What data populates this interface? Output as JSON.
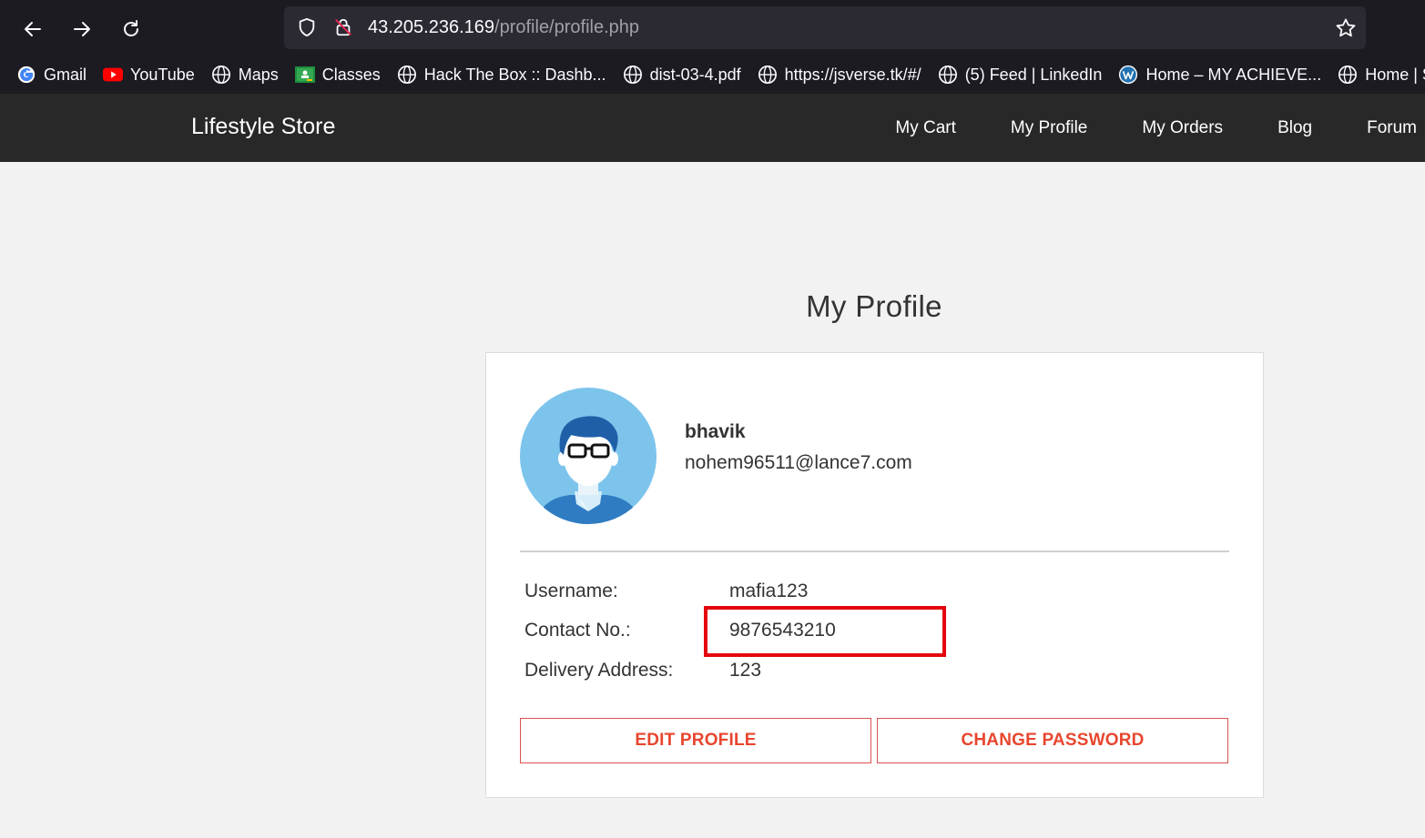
{
  "browser": {
    "url_host": "43.205.236.169",
    "url_path": "/profile/profile.php",
    "bookmarks": [
      {
        "label": "Gmail",
        "icon": "google-icon"
      },
      {
        "label": "YouTube",
        "icon": "youtube-icon"
      },
      {
        "label": "Maps",
        "icon": "globe-icon"
      },
      {
        "label": "Classes",
        "icon": "classroom-icon"
      },
      {
        "label": "Hack The Box :: Dashb...",
        "icon": "globe-icon"
      },
      {
        "label": "dist-03-4.pdf",
        "icon": "globe-icon"
      },
      {
        "label": "https://jsverse.tk/#/",
        "icon": "globe-icon"
      },
      {
        "label": "(5) Feed | LinkedIn",
        "icon": "globe-icon"
      },
      {
        "label": "Home – MY ACHIEVE...",
        "icon": "wordpress-icon"
      },
      {
        "label": "Home | Sp",
        "icon": "globe-icon"
      }
    ]
  },
  "site": {
    "brand": "Lifestyle Store",
    "menu": [
      "My Cart",
      "My Profile",
      "My Orders",
      "Blog",
      "Forum"
    ]
  },
  "profile": {
    "title": "My Profile",
    "name": "bhavik",
    "email": "nohem96511@lance7.com",
    "fields": [
      {
        "label": "Username:",
        "value": "mafia123"
      },
      {
        "label": "Contact No.:",
        "value": "9876543210"
      },
      {
        "label": "Delivery Address:",
        "value": "123"
      }
    ],
    "edit_button": "EDIT PROFILE",
    "password_button": "CHANGE PASSWORD"
  },
  "colors": {
    "chrome_bg": "#1c1b22",
    "navbar_bg": "#282828",
    "accent": "#e8462f",
    "highlight": "#e5060d"
  }
}
